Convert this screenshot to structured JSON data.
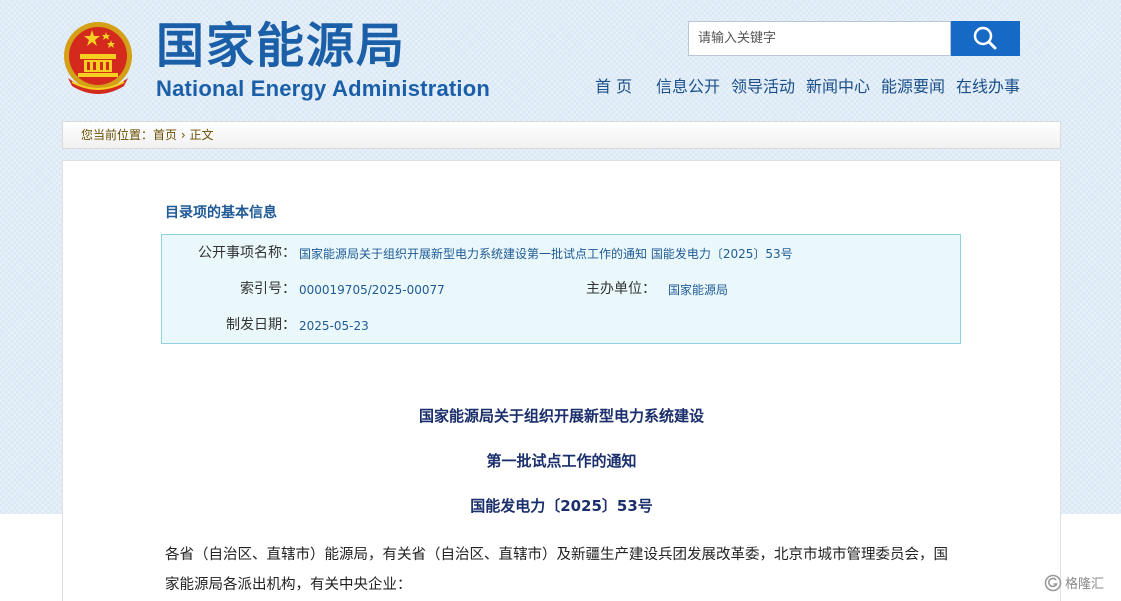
{
  "header": {
    "logo_cn": "国家能源局",
    "logo_en": "National Energy Administration",
    "search_placeholder": "请输入关键字"
  },
  "nav": {
    "items": [
      "首 页",
      "信息公开",
      "领导活动",
      "新闻中心",
      "能源要闻",
      "在线办事"
    ]
  },
  "breadcrumb": {
    "prefix": "您当前位置：",
    "home": "首页",
    "separator": "›",
    "current": "正文"
  },
  "info": {
    "section_title": "目录项的基本信息",
    "name_label": "公开事项名称：",
    "name_value": "国家能源局关于组织开展新型电力系统建设第一批试点工作的通知 国能发电力〔2025〕53号",
    "index_label": "索引号：",
    "index_value": "000019705/2025-00077",
    "org_label": "主办单位：",
    "org_value": "国家能源局",
    "date_label": "制发日期：",
    "date_value": "2025-05-23"
  },
  "document": {
    "title_line1": "国家能源局关于组织开展新型电力系统建设",
    "title_line2": "第一批试点工作的通知",
    "doc_number": "国能发电力〔2025〕53号",
    "body_para1": "各省（自治区、直辖市）能源局，有关省（自治区、直辖市）及新疆生产建设兵团发展改革委，北京市城市管理委员会，国家能源局各派出机构，有关中央企业："
  },
  "watermark": {
    "text": "格隆汇"
  },
  "colors": {
    "brand_blue": "#1a5fa8",
    "search_button": "#1769c6",
    "info_bg": "#eaf8fb",
    "info_border": "#8dd3df"
  }
}
